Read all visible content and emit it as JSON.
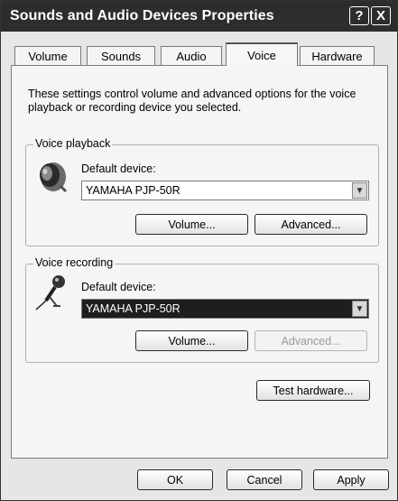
{
  "window": {
    "title": "Sounds and Audio Devices Properties",
    "help_glyph": "?",
    "close_glyph": "X"
  },
  "tabs": [
    {
      "label": "Volume"
    },
    {
      "label": "Sounds"
    },
    {
      "label": "Audio"
    },
    {
      "label": "Voice",
      "active": true
    },
    {
      "label": "Hardware"
    }
  ],
  "description": "These settings control volume and advanced options for the voice playback or recording device you selected.",
  "playback": {
    "group_label": "Voice playback",
    "default_device_label": "Default device:",
    "device_value": "YAMAHA PJP-50R",
    "volume_button": "Volume...",
    "advanced_button": "Advanced..."
  },
  "recording": {
    "group_label": "Voice recording",
    "default_device_label": "Default device:",
    "device_value": "YAMAHA PJP-50R",
    "volume_button": "Volume...",
    "advanced_button": "Advanced..."
  },
  "test_hardware_button": "Test hardware...",
  "footer": {
    "ok": "OK",
    "cancel": "Cancel",
    "apply": "Apply"
  },
  "icons": {
    "speaker": "speaker-icon",
    "microphone": "microphone-icon",
    "dropdown": "chevron-down-icon"
  }
}
